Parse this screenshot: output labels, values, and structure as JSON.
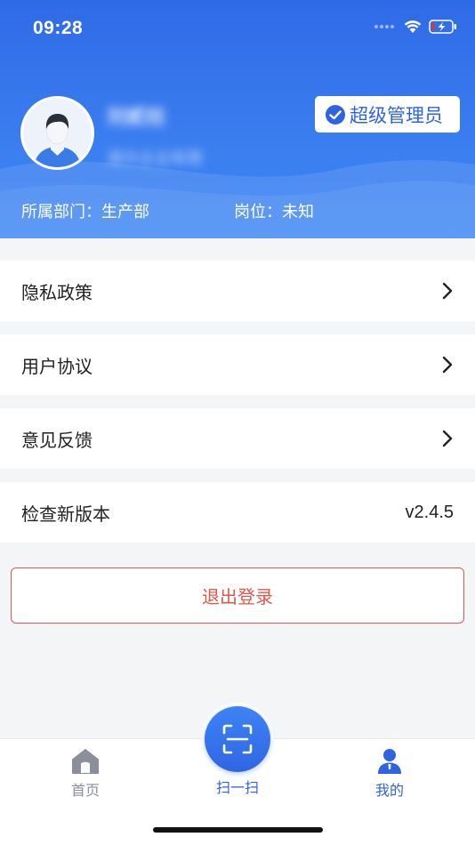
{
  "status_bar": {
    "time": "09:28"
  },
  "profile": {
    "name": "刘贰柱",
    "company": "演示企业有限",
    "role": "超级管理员",
    "department_label": "所属部门：",
    "department": "生产部",
    "post_label": "岗位：",
    "post": "未知"
  },
  "menu": {
    "privacy": "隐私政策",
    "agreement": "用户协议",
    "feedback": "意见反馈",
    "check_version": "检查新版本",
    "version": "v2.4.5"
  },
  "logout_label": "退出登录",
  "tabbar": {
    "home": "首页",
    "scan": "扫一扫",
    "mine": "我的"
  },
  "colors": {
    "primary": "#2f63e0",
    "header_top": "#2f6ae6",
    "logout": "#e0574a",
    "inactive_tab": "#8a8f99"
  }
}
